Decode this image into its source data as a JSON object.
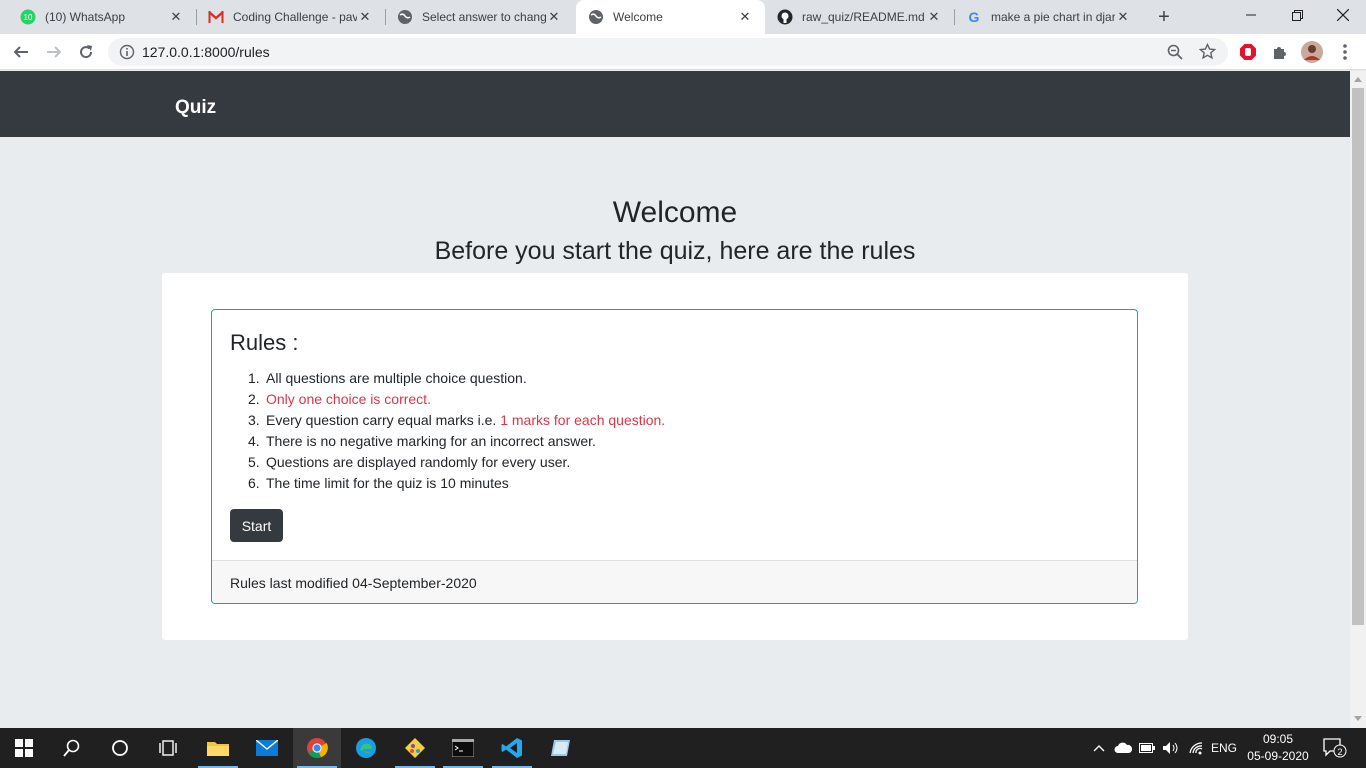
{
  "browser": {
    "tabs": [
      {
        "title": "(10) WhatsApp",
        "icon": "whatsapp-icon"
      },
      {
        "title": "Coding Challenge - pav",
        "icon": "gmail-icon"
      },
      {
        "title": "Select answer to chang",
        "icon": "globe-icon"
      },
      {
        "title": "Welcome",
        "icon": "globe-icon",
        "active": true
      },
      {
        "title": "raw_quiz/README.md a",
        "icon": "github-icon"
      },
      {
        "title": "make a pie chart in djar",
        "icon": "google-icon"
      }
    ],
    "whatsapp_badge": "10",
    "url": "127.0.0.1:8000/rules"
  },
  "page": {
    "brand": "Quiz",
    "heading": "Welcome",
    "subheading": "Before you start the quiz, here are the rules",
    "rules_title": "Rules :",
    "rules": [
      {
        "num": "1.",
        "parts": [
          {
            "text": "All questions are multiple choice question.",
            "highlight": false
          }
        ]
      },
      {
        "num": "2.",
        "parts": [
          {
            "text": "Only one choice is correct.",
            "highlight": true
          }
        ]
      },
      {
        "num": "3.",
        "parts": [
          {
            "text": "Every question carry equal marks i.e. ",
            "highlight": false
          },
          {
            "text": "1 marks for each question.",
            "highlight": true
          }
        ]
      },
      {
        "num": "4.",
        "parts": [
          {
            "text": "There is no negative marking for an incorrect answer.",
            "highlight": false
          }
        ]
      },
      {
        "num": "5.",
        "parts": [
          {
            "text": "Questions are displayed randomly for every user.",
            "highlight": false
          }
        ]
      },
      {
        "num": "6.",
        "parts": [
          {
            "text": "The time limit for the quiz is 10 minutes",
            "highlight": false
          }
        ]
      }
    ],
    "start_label": "Start",
    "footer": "Rules last modified 04-September-2020"
  },
  "taskbar": {
    "language": "ENG",
    "time": "09:05",
    "date": "05-09-2020",
    "notifications": "2"
  },
  "colors": {
    "navbar": "#343a40",
    "card_border": "#17a2b8",
    "highlight": "#dc3545",
    "page_bg": "#e9ecef"
  }
}
